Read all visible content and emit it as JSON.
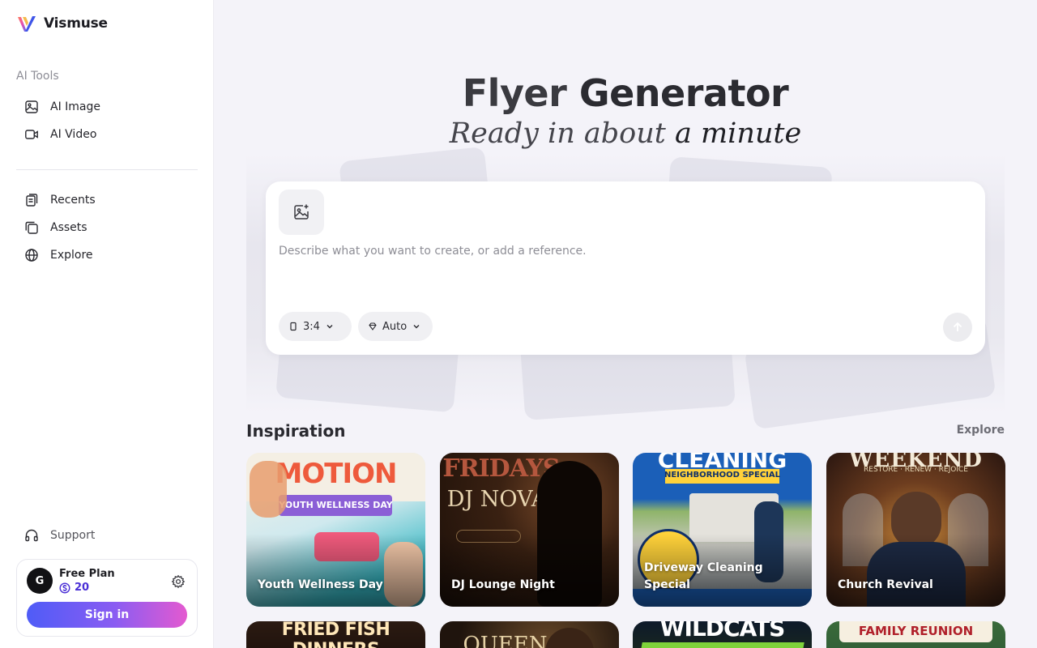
{
  "brand": {
    "name": "Vismuse"
  },
  "sidebar": {
    "section_label": "AI Tools",
    "tools": [
      {
        "label": "AI Image",
        "icon": "image-icon"
      },
      {
        "label": "AI Video",
        "icon": "video-icon"
      }
    ],
    "nav": [
      {
        "label": "Recents",
        "icon": "recents-icon"
      },
      {
        "label": "Assets",
        "icon": "assets-icon"
      },
      {
        "label": "Explore",
        "icon": "globe-icon"
      }
    ],
    "support_label": "Support",
    "plan": {
      "avatar_initial": "G",
      "name": "Free Plan",
      "credits": "20",
      "signin_label": "Sign in"
    }
  },
  "hero": {
    "title_part1": "Flyer",
    "title_part2": "Generator",
    "subtitle_part1": "Ready in about",
    "subtitle_part2": "a minute"
  },
  "prompt": {
    "placeholder": "Describe what you want to create, or add a reference.",
    "ratio": "3:4",
    "style": "Auto"
  },
  "inspiration": {
    "title": "Inspiration",
    "explore_label": "Explore",
    "cards": [
      {
        "label": "Youth Wellness Day",
        "art": [
          "MOTION",
          "YOUTH WELLNESS DAY"
        ]
      },
      {
        "label": "DJ Lounge Night",
        "art": [
          "FRIDAYS",
          "DJ NOVA"
        ]
      },
      {
        "label": "Driveway Cleaning Special",
        "art": [
          "CLEANING",
          "NEIGHBORHOOD SPECIAL"
        ]
      },
      {
        "label": "Church Revival",
        "art": [
          "WEEKEND",
          "RESTORE · RENEW · REJOICE"
        ]
      }
    ],
    "cards_row2": [
      {
        "art": "FRIED FISH DINNERS"
      },
      {
        "art": "QUEEN"
      },
      {
        "art": "WILDCATS"
      },
      {
        "art": "FAMILY REUNION"
      }
    ]
  },
  "colors": {
    "accent_start": "#4f5cf7",
    "accent_end": "#e45ad0",
    "credits": "#4a2fd6"
  }
}
